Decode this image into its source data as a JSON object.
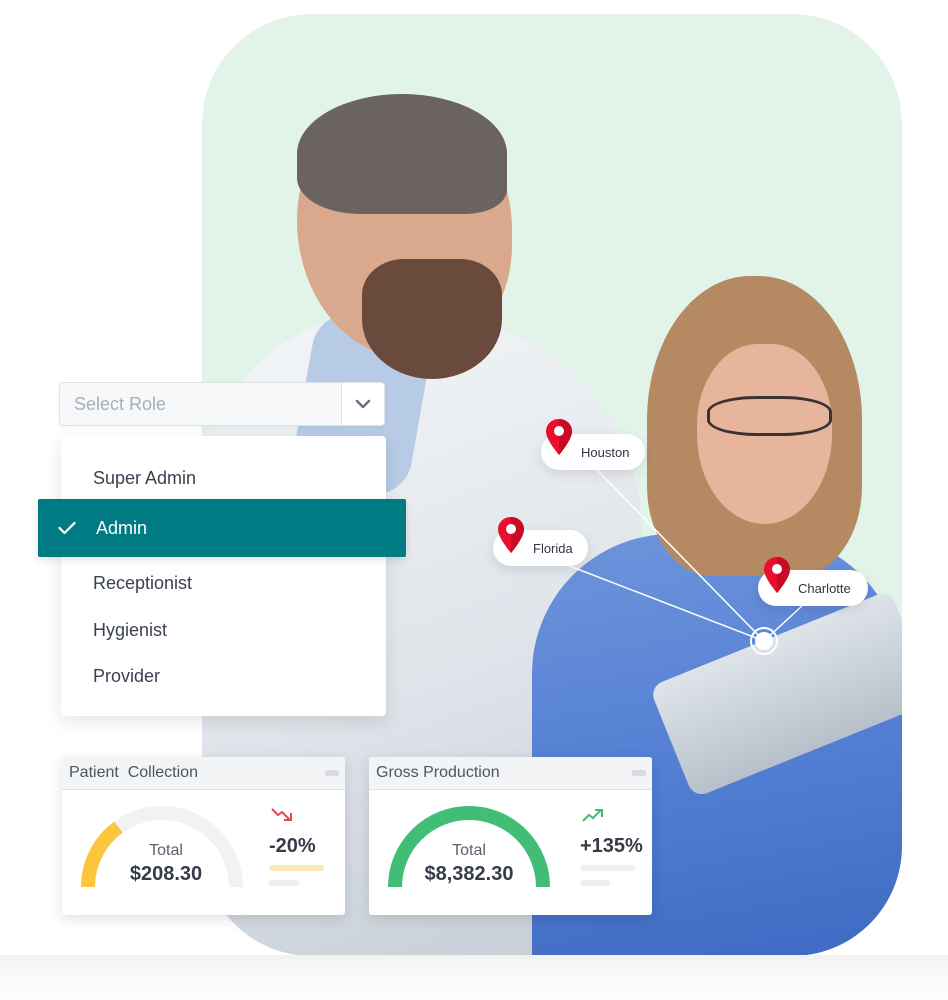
{
  "role_select": {
    "placeholder": "Select Role",
    "options": [
      "Super Admin",
      "Admin",
      "Receptionist",
      "Hygienist",
      "Provider"
    ],
    "selected": "Admin"
  },
  "locations": [
    {
      "label": "Houston"
    },
    {
      "label": "Florida"
    },
    {
      "label": "Charlotte"
    }
  ],
  "cards": [
    {
      "title": "Patient  Collection",
      "total_label": "Total",
      "total_value": "$208.30",
      "change": "-20%",
      "trend": "down",
      "gauge_fraction": 0.3,
      "gauge_color": "#fcc53c",
      "trend_color": "#e5484d",
      "bar_color": "#fce9b6"
    },
    {
      "title": "Gross Production",
      "total_label": "Total",
      "total_value": "$8,382.30",
      "change": "+135%",
      "trend": "up",
      "gauge_fraction": 1.0,
      "gauge_color": "#41bd76",
      "trend_color": "#41bd76",
      "bar_color": "#eceef1"
    }
  ],
  "colors": {
    "accent": "#007b84",
    "background": "#e2f4ea",
    "pin": "#e8102e"
  }
}
